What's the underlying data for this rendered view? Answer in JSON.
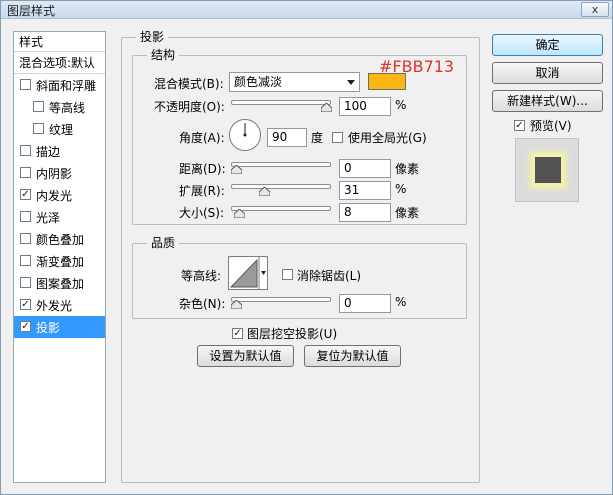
{
  "window": {
    "title": "图层样式",
    "close": "x"
  },
  "stylelist": {
    "header": "样式",
    "blend": "混合选项:默认",
    "items": [
      {
        "label": "斜面和浮雕",
        "checked": false,
        "sub": false
      },
      {
        "label": "等高线",
        "checked": false,
        "sub": true
      },
      {
        "label": "纹理",
        "checked": false,
        "sub": true
      },
      {
        "label": "描边",
        "checked": false,
        "sub": false
      },
      {
        "label": "内阴影",
        "checked": false,
        "sub": false
      },
      {
        "label": "内发光",
        "checked": true,
        "sub": false
      },
      {
        "label": "光泽",
        "checked": false,
        "sub": false
      },
      {
        "label": "颜色叠加",
        "checked": false,
        "sub": false
      },
      {
        "label": "渐变叠加",
        "checked": false,
        "sub": false
      },
      {
        "label": "图案叠加",
        "checked": false,
        "sub": false
      },
      {
        "label": "外发光",
        "checked": true,
        "sub": false
      },
      {
        "label": "投影",
        "checked": true,
        "sub": false,
        "selected": true
      }
    ]
  },
  "panel": {
    "title": "投影",
    "structure": {
      "title": "结构",
      "blend_mode_label": "混合模式(B):",
      "blend_mode_value": "颜色减淡",
      "color": "#FBB713",
      "color_annotation": "#FBB713",
      "opacity_label": "不透明度(O):",
      "opacity_value": "100",
      "opacity_unit": "%",
      "opacity_level": 1.0,
      "angle_label": "角度(A):",
      "angle_value": "90",
      "angle_unit": "度",
      "global_light_label": "使用全局光(G)",
      "global_light_checked": false,
      "distance_label": "距离(D):",
      "distance_value": "0",
      "distance_unit": "像素",
      "distance_level": 0.0,
      "spread_label": "扩展(R):",
      "spread_value": "31",
      "spread_unit": "%",
      "spread_level": 0.31,
      "size_label": "大小(S):",
      "size_value": "8",
      "size_unit": "像素",
      "size_level": 0.03
    },
    "quality": {
      "title": "品质",
      "contour_label": "等高线:",
      "antialias_label": "消除锯齿(L)",
      "antialias_checked": false,
      "noise_label": "杂色(N):",
      "noise_value": "0",
      "noise_unit": "%",
      "noise_level": 0.0
    },
    "knockout_label": "图层挖空投影(U)",
    "knockout_checked": true,
    "make_default": "设置为默认值",
    "reset_default": "复位为默认值"
  },
  "buttons": {
    "ok": "确定",
    "cancel": "取消",
    "new_style": "新建样式(W)...",
    "preview_label": "预览(V)",
    "preview_checked": true
  },
  "colors": {
    "selection": "#3399ff",
    "shadow_color": "#FBB713",
    "annotation": "#e0332b"
  }
}
